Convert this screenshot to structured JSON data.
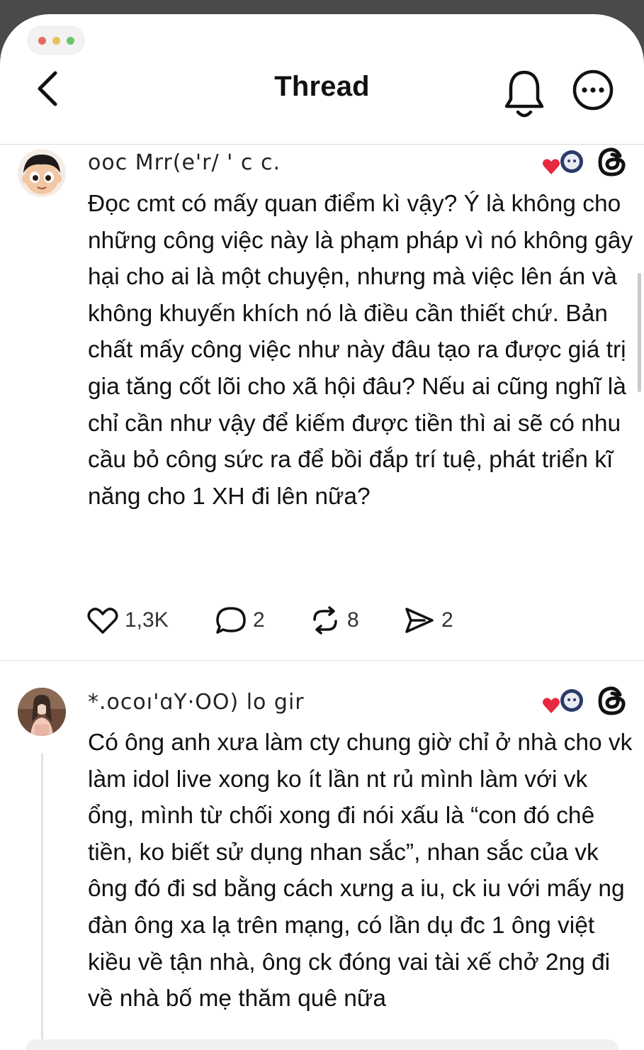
{
  "header": {
    "title": "Thread",
    "window_dot_colors": [
      "#e36b5f",
      "#e7c05a",
      "#6fc46a"
    ]
  },
  "posts": [
    {
      "username": "ooc Mrr(e'r/ ' c c.",
      "avatar_icon": "cartoon-avatar",
      "text": "Đọc cmt có mấy quan điểm kì vậy? Ý là không cho những công việc này là phạm pháp vì nó không gây hại cho ai là một chuyện, nhưng mà việc lên án và không khuyến khích nó là điều cần thiết chứ. Bản chất mấy công việc như này đâu tạo ra được giá trị gia tăng cốt lõi cho xã hội đâu? Nếu ai cũng nghĩ là chỉ cần như vậy để kiếm được tiền thì ai sẽ có nhu cầu bỏ công sức ra để bồi đắp trí tuệ, phát triển kĩ năng cho 1 XH đi lên nữa?",
      "likes": "1,3K",
      "replies": "2",
      "reposts": "8",
      "shares": "2"
    },
    {
      "username": "*.ocoı'ɑY·OO)  lo gir",
      "avatar_icon": "photo-avatar",
      "text": "Có ông anh xưa làm cty chung giờ chỉ ở nhà cho vk làm idol live xong ko ít lần nt rủ mình làm với vk ổng, mình từ chối xong đi nói xấu là “con đó chê tiền, ko biết sử dụng nhan sắc”, nhan sắc của vk ông đó đi sd bằng cách xưng a iu, ck iu với mấy ng đàn ông xa lạ trên mạng, có lần dụ đc 1 ông việt kiều về tận nhà, ông ck đóng vai tài xế chở 2ng đi về nhà bố mẹ thăm quê nữa"
    }
  ],
  "colors": {
    "accent_heart": "#e8283f",
    "badge_bg": "#2b3a6b",
    "text": "#111111"
  }
}
